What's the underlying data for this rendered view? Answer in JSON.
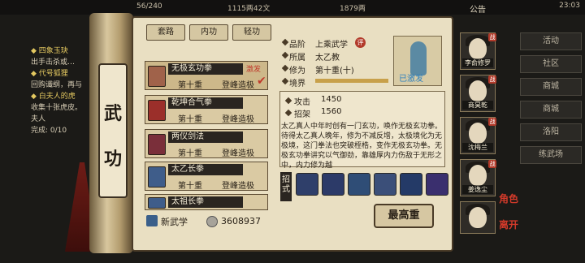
{
  "hud": {
    "res1": "56/240",
    "res2": "1115两42文",
    "res3": "1879两",
    "notice": "公告",
    "clock": "23:03",
    "quest_lines": [
      "◆ 四象玉玦",
      "出手击杀或…",
      "◆ 代号狐狸",
      "回购谶纲，再与",
      "◆ 白夫人的虎",
      "收集十张虎皮。",
      "夫人",
      "完成: 0/10"
    ],
    "right_menu": [
      "活动",
      "社区",
      "商城",
      "商城",
      "洛阳",
      "练武场"
    ]
  },
  "panel": {
    "title_chars": [
      "武",
      "功"
    ],
    "tabs": [
      "套路",
      "内功",
      "轻功"
    ],
    "skills": [
      {
        "name": "无极玄功拳",
        "level": "第十重",
        "rank": "登峰造极",
        "tag": "激发",
        "active": true,
        "book_color": "#a0624a"
      },
      {
        "name": "乾坤合气拳",
        "level": "第十重",
        "rank": "登峰造极",
        "active": false,
        "book_color": "#9b2f2a"
      },
      {
        "name": "两仪剑法",
        "level": "第十重",
        "rank": "登峰造极",
        "active": false,
        "book_color": "#7a2f3a"
      },
      {
        "name": "太乙长拳",
        "level": "第十重",
        "rank": "登峰造极",
        "active": false,
        "book_color": "#3f5d8a"
      },
      {
        "name": "太祖长拳",
        "level": "",
        "rank": "",
        "active": false,
        "book_color": "#3f5d8a"
      }
    ],
    "new_skill": "新武学",
    "coins": "3608937",
    "detail": {
      "grade_label": "品阶",
      "grade_value": "上乘武学",
      "grade_badge": "评",
      "sect_label": "所属",
      "sect_value": "太乙教",
      "level_label": "修为",
      "level_value": "第十重(十)",
      "realm_label": "境界",
      "realm_progress": 1.0,
      "portrait_tag": "已激发",
      "attack_label": "攻击",
      "attack_value": "1450",
      "parry_label": "招架",
      "parry_value": "1560",
      "description": "太乙真人中年时创有一门玄功，唤作无极玄功拳。待得太乙真人晚年，修为不减反增，太极境化为无极境，这门拳法也突破桎梏，变作无极玄功拳。无极玄功拳讲究以气御劲，靠雄厚内力伤敌于无形之中，内力修为越",
      "moves_label": "招式",
      "moves": [
        "move1",
        "move2",
        "move3",
        "move4",
        "move5",
        "move6"
      ],
      "max_button": "最高重"
    },
    "characters": [
      {
        "name": "李俞修罗",
        "badge": "战"
      },
      {
        "name": "商昊乾",
        "badge": "战"
      },
      {
        "name": "沈梅兰",
        "badge": "战"
      },
      {
        "name": "姜逸尘",
        "badge": "战"
      },
      {
        "name": "",
        "badge": ""
      }
    ],
    "side_labels": [
      "角色",
      "离开"
    ]
  }
}
